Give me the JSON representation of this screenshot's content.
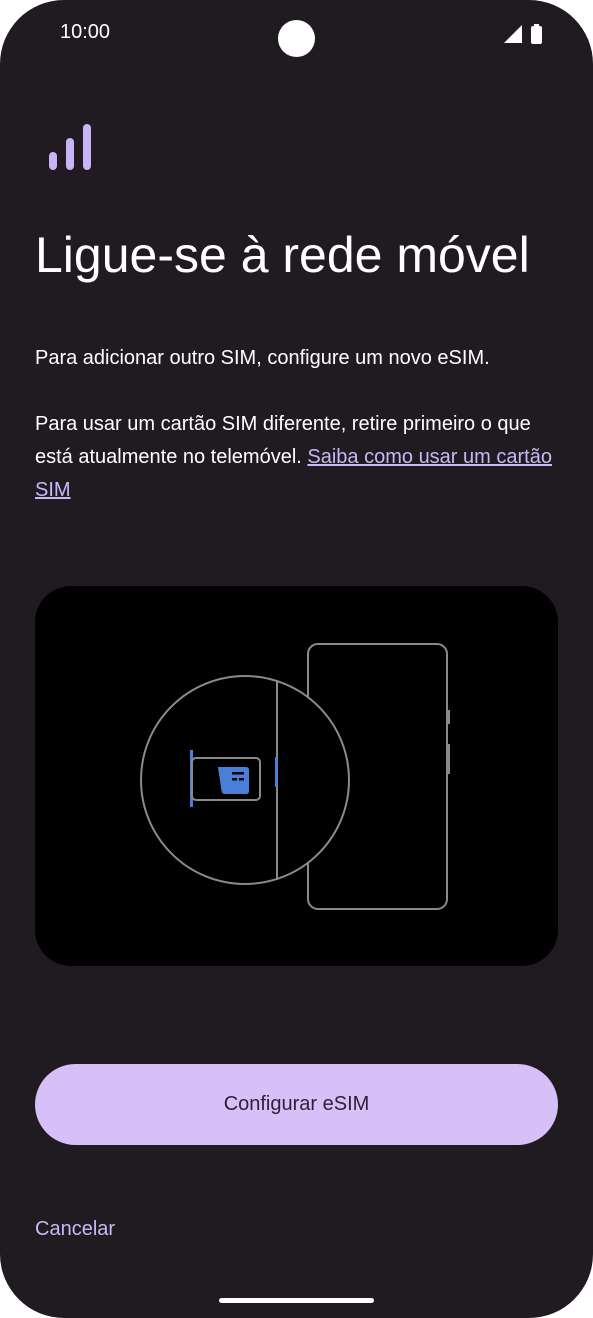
{
  "status_bar": {
    "time": "10:00",
    "icons": [
      "signal-icon",
      "battery-icon"
    ]
  },
  "header_icon": "cellular-signal-icon",
  "title": "Ligue-se à rede móvel",
  "body": {
    "paragraph1": "Para adicionar outro SIM, configure um novo eSIM.",
    "paragraph2_text": "Para usar um cartão SIM diferente, retire primeiro o que está atualmente no telemóvel.",
    "paragraph2_link": "Saiba como usar um cartão SIM"
  },
  "illustration": {
    "name": "sim-tray-illustration",
    "icons": [
      "phone-outline",
      "sim-card-icon",
      "magnifier-circle"
    ]
  },
  "actions": {
    "primary_label": "Configurar eSIM",
    "cancel_label": "Cancelar"
  },
  "colors": {
    "background": "#1f1b21",
    "accent": "#d7c0f8",
    "link": "#c9b8f5",
    "sim_blue": "#4a7fd8",
    "outline": "#8a8a8a"
  }
}
